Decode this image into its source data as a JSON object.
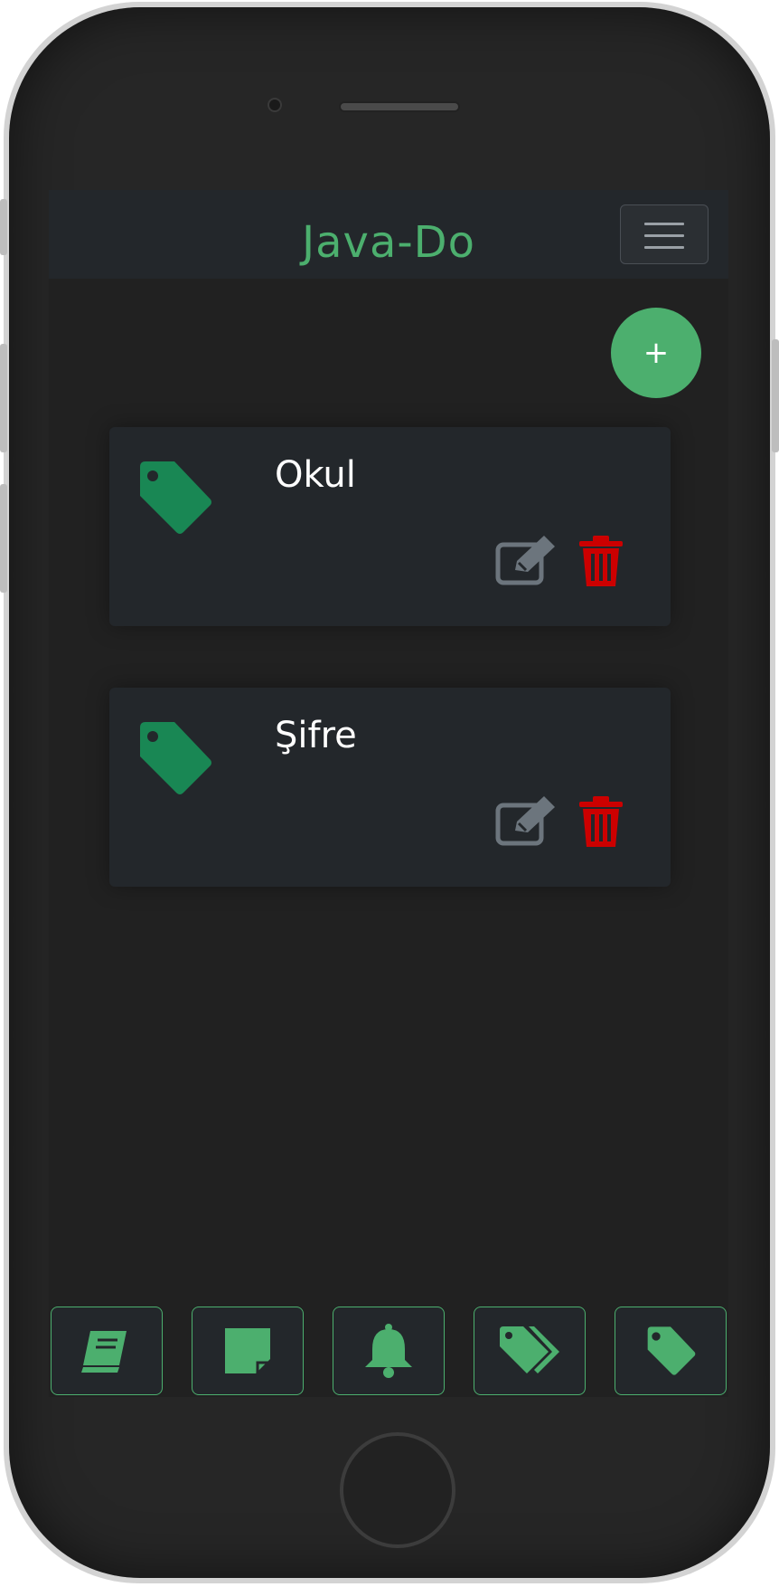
{
  "app": {
    "brand": "Java-Do",
    "accent_color": "#4caf6e",
    "danger_color": "#cc0000"
  },
  "header": {
    "menu_icon": "hamburger-icon"
  },
  "fab": {
    "label": "+"
  },
  "categories": [
    {
      "name": "Okul",
      "icon": "tag-icon",
      "edit_icon": "edit-icon",
      "delete_icon": "trash-icon"
    },
    {
      "name": "Şifre",
      "icon": "tag-icon",
      "edit_icon": "edit-icon",
      "delete_icon": "trash-icon"
    }
  ],
  "bottom_nav": [
    {
      "icon": "book-icon"
    },
    {
      "icon": "sticky-note-icon"
    },
    {
      "icon": "bell-icon"
    },
    {
      "icon": "tags-icon"
    },
    {
      "icon": "tag-icon"
    }
  ]
}
